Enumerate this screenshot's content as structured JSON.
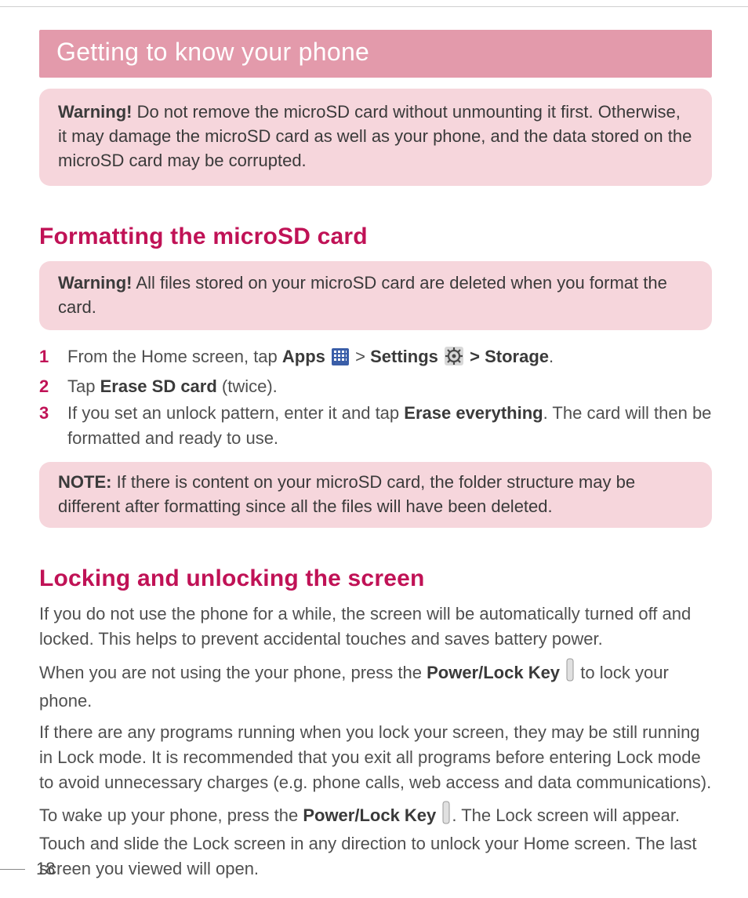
{
  "banner": {
    "title": "Getting to know your phone"
  },
  "warning1": {
    "lead": "Warning!",
    "text": " Do not remove the microSD card without unmounting it first. Otherwise, it may damage the microSD card as well as your phone, and the data stored on the microSD card may be corrupted."
  },
  "section1": {
    "title": "Formatting the microSD card"
  },
  "warning2": {
    "lead": "Warning!",
    "text": " All files stored on your microSD card are deleted when you format the card."
  },
  "steps": {
    "1": {
      "num": "1",
      "a": "From the Home screen, tap ",
      "apps": "Apps",
      "gt": " > ",
      "settings": "Settings",
      "storage": " > Storage",
      "dot": "."
    },
    "2": {
      "num": "2",
      "a": "Tap ",
      "b": "Erase SD card",
      "c": " (twice)."
    },
    "3": {
      "num": "3",
      "a": "If you set an unlock pattern, enter it and tap ",
      "b": "Erase everything",
      "c": ". The card will then be formatted and ready to use."
    }
  },
  "note": {
    "lead": "NOTE:",
    "text": " If there is content on your microSD card, the folder structure may be different after formatting since all the files will have been deleted."
  },
  "section2": {
    "title": "Locking and unlocking the screen"
  },
  "para1": "If you do not use the phone for a while, the screen will be automatically turned off and locked. This helps to prevent accidental touches and saves battery power.",
  "para2": {
    "a": "When you are not using the your phone, press the ",
    "b": "Power/Lock Key",
    "c": " to lock your phone."
  },
  "para3": "If there are any programs running when you lock your screen, they may be still running in Lock mode. It is recommended that you exit all programs before entering Lock mode to avoid unnecessary charges (e.g. phone calls, web access and data communications).",
  "para4": {
    "a": "To wake up your phone, press the ",
    "b": "Power/Lock Key",
    "c": ". The Lock screen will appear. Touch and slide the Lock screen in any direction to unlock your Home screen. The last screen you viewed will open."
  },
  "pageNumber": "18"
}
